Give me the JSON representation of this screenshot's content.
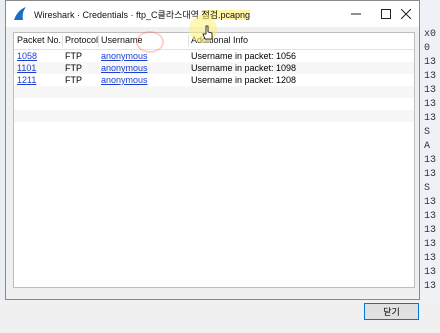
{
  "window": {
    "app_name": "Wireshark",
    "separator": " · ",
    "dialog_name": "Credentials",
    "file_name_pre": "ftp_C클라스대역 ",
    "file_name_hl": "점검.pcapng"
  },
  "table": {
    "columns": [
      "Packet No.",
      "Protocol",
      "Username",
      "Additional Info"
    ],
    "rows": [
      {
        "packet_no": "1058",
        "protocol": "FTP",
        "username": "anonymous",
        "info": "Username in packet: 1056"
      },
      {
        "packet_no": "1101",
        "protocol": "FTP",
        "username": "anonymous",
        "info": "Username in packet: 1098"
      },
      {
        "packet_no": "1211",
        "protocol": "FTP",
        "username": "anonymous",
        "info": "Username in packet: 1208"
      }
    ]
  },
  "buttons": {
    "close_label": "닫기"
  },
  "background": {
    "side_cells": [
      "x0",
      "0",
      "13",
      "13",
      "13",
      "13",
      "13",
      "S",
      "A",
      "13",
      "13",
      "S",
      "13",
      "13",
      "13",
      "13",
      "13",
      "13",
      "13"
    ]
  },
  "colors": {
    "link": "#1a3fd1",
    "wireshark_blue": "#1a6fc4",
    "highlight": "#fff6a6",
    "accent_border": "#0078d7"
  }
}
